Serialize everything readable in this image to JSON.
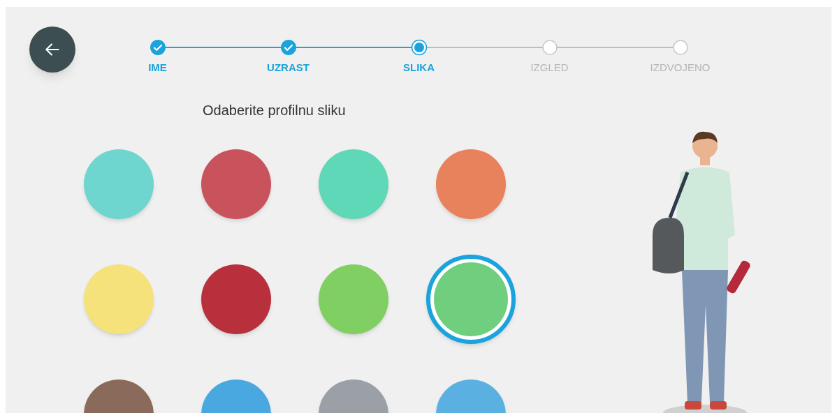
{
  "steps": [
    {
      "label": "IME",
      "kind": "done"
    },
    {
      "label": "UZRAST",
      "kind": "done"
    },
    {
      "label": "SLIKA",
      "kind": "current"
    },
    {
      "label": "IZGLED",
      "kind": "pending"
    },
    {
      "label": "IZDVOJENO",
      "kind": "pending"
    }
  ],
  "heading": "Odaberite profilnu sliku",
  "avatars": [
    {
      "color": "#6fd6cf",
      "selected": false
    },
    {
      "color": "#c9535d",
      "selected": false
    },
    {
      "color": "#5fd8b8",
      "selected": false
    },
    {
      "color": "#e8825c",
      "selected": false
    },
    {
      "color": "#f5e27a",
      "selected": false
    },
    {
      "color": "#b8303c",
      "selected": false
    },
    {
      "color": "#7fcf62",
      "selected": false
    },
    {
      "color": "#6fcf7e",
      "selected": true
    },
    {
      "color": "#8a6a5a",
      "selected": false
    },
    {
      "color": "#4aa8e0",
      "selected": false
    },
    {
      "color": "#9aa0a6",
      "selected": false
    },
    {
      "color": "#5ab0e0",
      "selected": false
    }
  ]
}
